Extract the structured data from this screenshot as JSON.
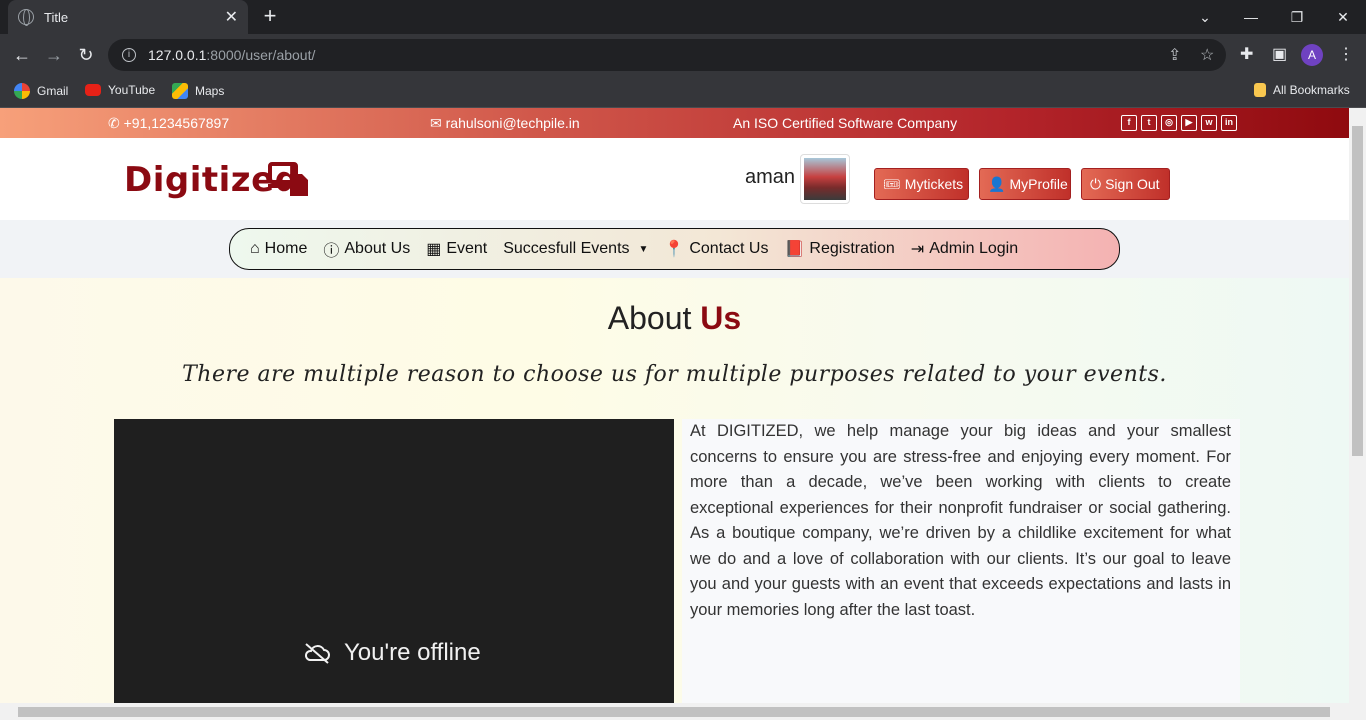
{
  "browser": {
    "tab_title": "Title",
    "url_host": "127.0.0.1",
    "url_path": ":8000/user/about/",
    "profile_initial": "A",
    "bookmarks": [
      {
        "label": "Gmail"
      },
      {
        "label": "YouTube"
      },
      {
        "label": "Maps"
      }
    ],
    "all_bookmarks": "All Bookmarks"
  },
  "topbar": {
    "phone": "+91,1234567897",
    "email": "rahulsoni@techpile.in",
    "tagline": "An ISO Certified Software Company",
    "social": [
      "f",
      "t",
      "◎",
      "▶",
      "w",
      "in"
    ]
  },
  "header": {
    "brand": "Digitized",
    "username": "aman",
    "buttons": {
      "mytickets": "Mytickets",
      "myprofile": "MyProfile",
      "signout": "Sign Out"
    }
  },
  "nav": {
    "home": "Home",
    "about": "About Us",
    "event": "Event",
    "successful": "Succesfull Events",
    "contact": "Contact Us",
    "registration": "Registration",
    "admin": "Admin Login"
  },
  "main": {
    "heading_plain": "About",
    "heading_accent": "Us",
    "tagline": "There are multiple reason to choose us for multiple purposes related to your events.",
    "video_status": "You're offline",
    "paragraph": "At DIGITIZED, we help manage your big ideas and your smallest concerns to ensure you are stress-free and enjoying every moment. For more than a decade, we’ve been working with clients to create exceptional experiences for their nonprofit fundraiser or social gathering. As a boutique company, we’re driven by a childlike excitement for what we do and a love of collaboration with our clients. It’s our goal to leave you and your guests with an event that exceeds expectations and lasts in your memories long after the last toast."
  },
  "colors": {
    "brand": "#8b0a12",
    "button": "#c0302a"
  }
}
